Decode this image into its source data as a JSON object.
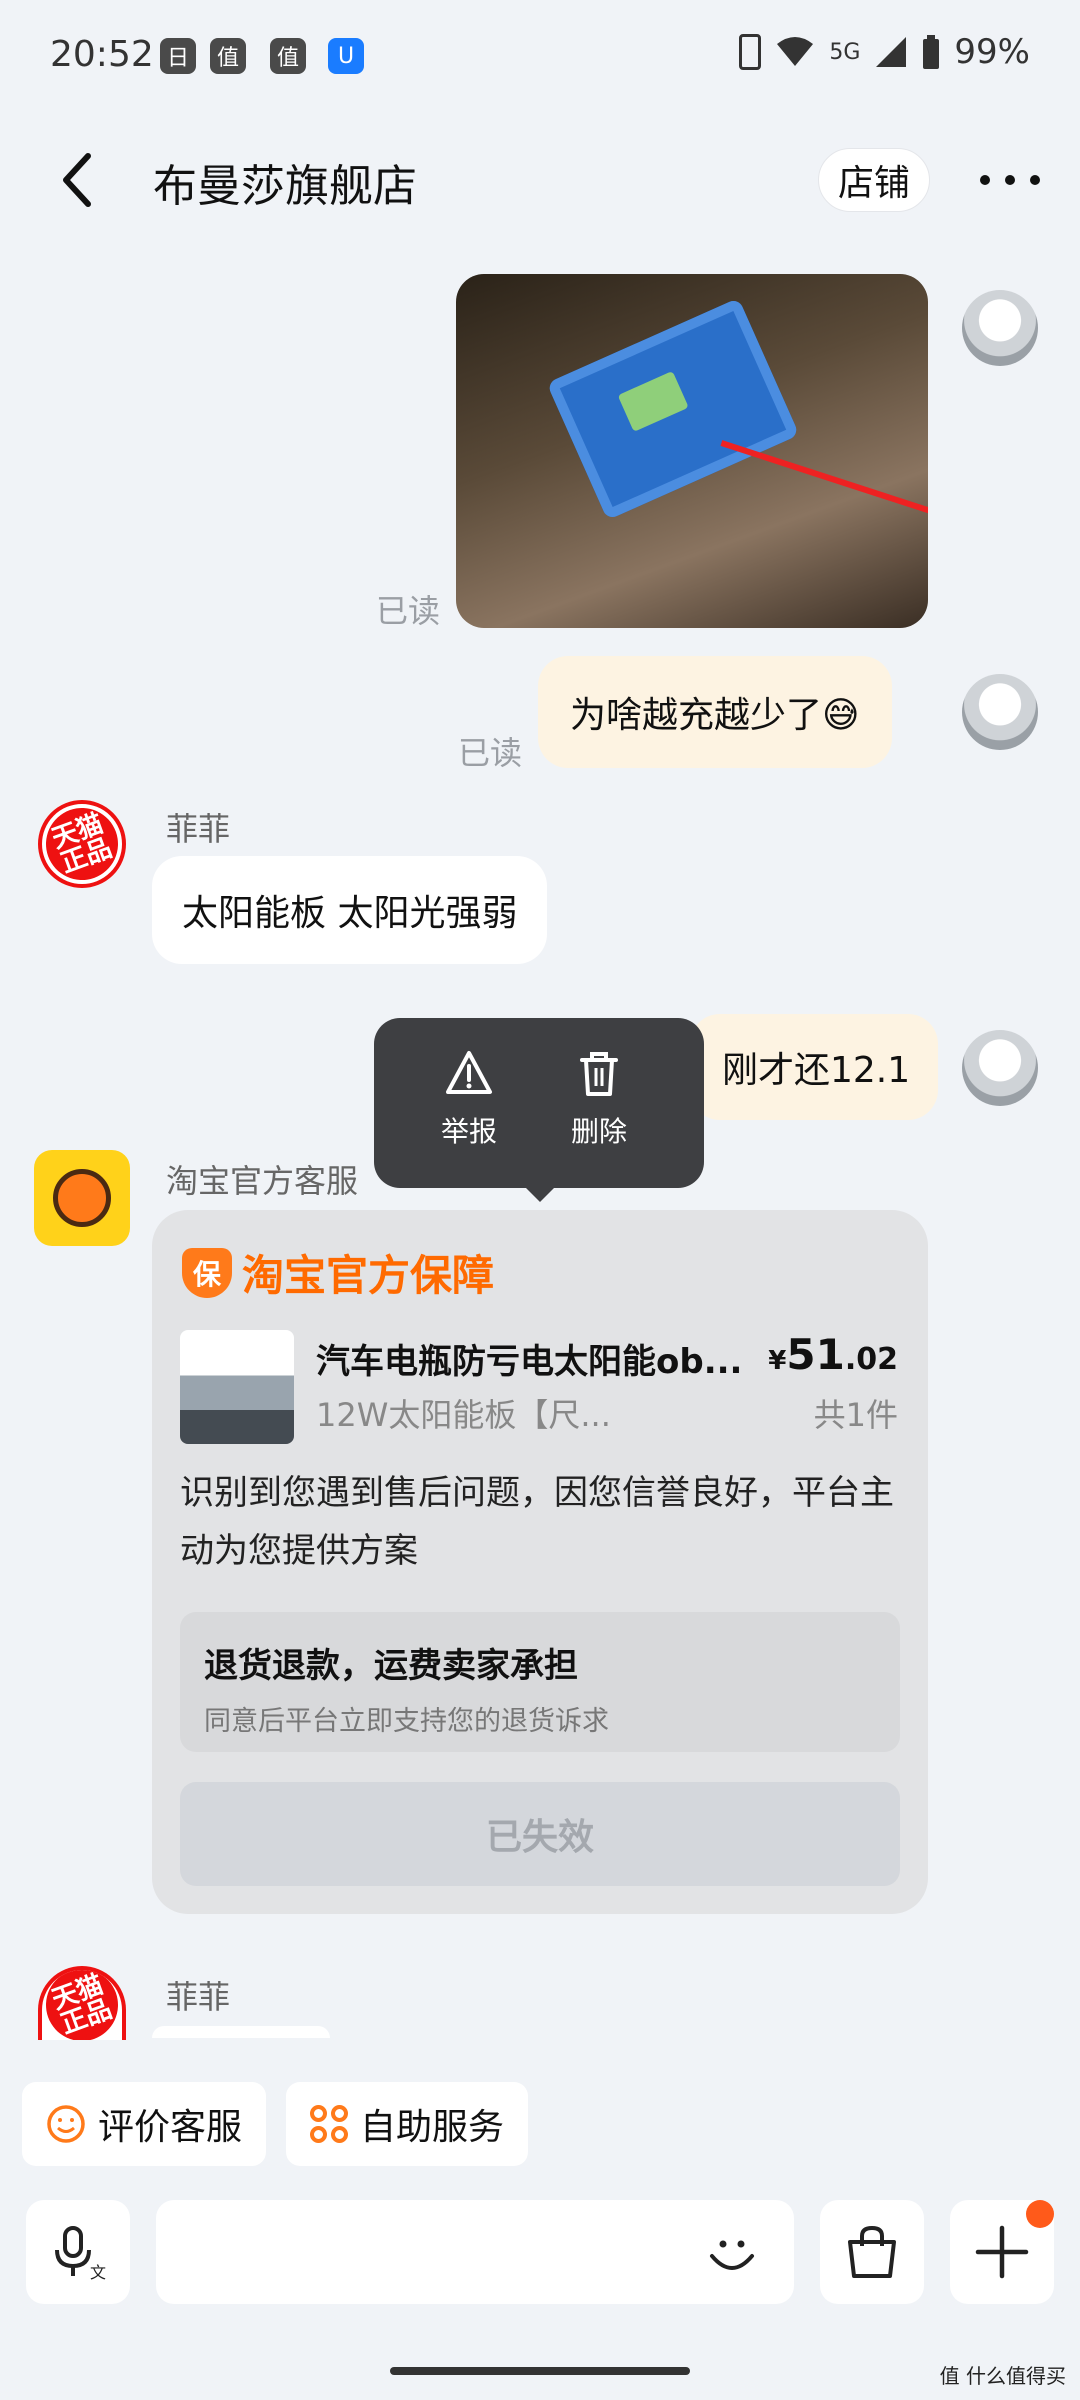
{
  "status_bar": {
    "time": "20:52",
    "notif_icons": [
      "日",
      "值",
      "值",
      "U"
    ],
    "network": "5G",
    "battery": "99%"
  },
  "header": {
    "title": "布曼莎旗舰店",
    "store_button": "店铺"
  },
  "messages": {
    "read_label": "已读",
    "my_text_1": "为啥越充越少了😅",
    "other_sender": "菲菲",
    "other_text_1": "太阳能板  太阳光强弱",
    "my_text_2": "刚才还12.1",
    "service_sender": "淘宝官方客服",
    "tmall_badge_line1": "天猫",
    "tmall_badge_line2": "正品"
  },
  "context_menu": {
    "report": "举报",
    "delete": "删除"
  },
  "card": {
    "logo_badge": "保",
    "logo_text": "淘宝官方保障",
    "product_title": "汽车电瓶防亏电太阳能ob...",
    "price_currency": "¥",
    "price_int": "51",
    "price_dec": ".02",
    "product_sub": "12W太阳能板【尺...",
    "quantity": "共1件",
    "body": "识别到您遇到售后问题，因您信誉良好，平台主动为您提供方案",
    "option_title": "退货退款，运费卖家承担",
    "option_sub": "同意后平台立即支持您的退货诉求",
    "button_label": "已失效"
  },
  "quick_actions": {
    "rate": "评价客服",
    "self_service": "自助服务"
  },
  "watermark": "值 什么值得买"
}
